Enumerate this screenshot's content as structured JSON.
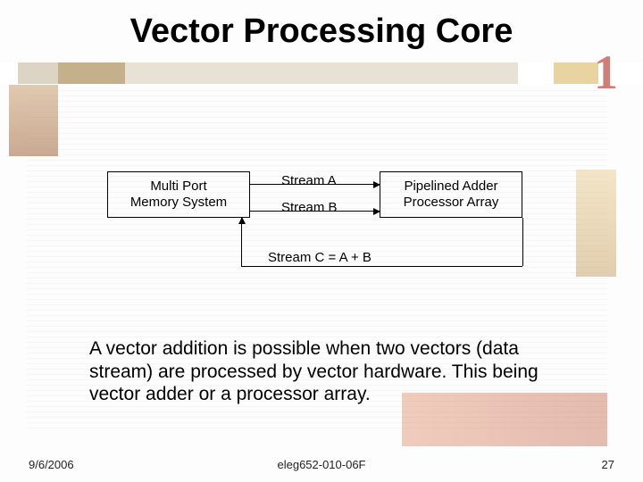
{
  "title": "Vector Processing Core",
  "diagram": {
    "left_box_line1": "Multi Port",
    "left_box_line2": "Memory System",
    "right_box_line1": "Pipelined Adder",
    "right_box_line2": "Processor Array",
    "stream_a": "Stream A",
    "stream_b": "Stream B",
    "stream_c": "Stream C = A + B"
  },
  "body": "A vector addition is possible when two vectors (data stream) are processed by vector hardware. This being vector adder or a processor array.",
  "footer": {
    "date": "9/6/2006",
    "course": "eleg652-010-06F",
    "page": "27"
  },
  "decor": {
    "corner_digit": "1"
  }
}
